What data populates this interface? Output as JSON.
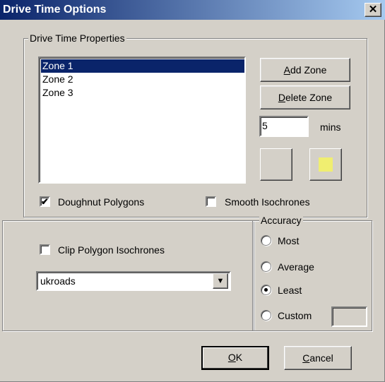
{
  "dialog": {
    "title": "Drive Time Options",
    "close_glyph": "✕"
  },
  "properties": {
    "group_label": "Drive Time Properties",
    "zones": [
      {
        "label": "Zone 1",
        "selected": true
      },
      {
        "label": "Zone 2",
        "selected": false
      },
      {
        "label": "Zone 3",
        "selected": false
      }
    ],
    "add_zone_label": "Add Zone",
    "delete_zone_label": "Delete Zone",
    "minutes_value": "5",
    "minutes_unit": "mins",
    "zone_color": "#f0ee70",
    "doughnut_label": "Doughnut Polygons",
    "doughnut_checked": true,
    "smooth_label": "Smooth Isochrones",
    "smooth_checked": false
  },
  "clip": {
    "label": "Clip Polygon Isochrones",
    "checked": false,
    "layer_value": "ukroads",
    "dropdown_icon": "▼"
  },
  "accuracy": {
    "group_label": "Accuracy",
    "options": [
      {
        "label": "Most",
        "selected": false
      },
      {
        "label": "Average",
        "selected": false
      },
      {
        "label": "Least",
        "selected": true
      },
      {
        "label": "Custom",
        "selected": false
      }
    ],
    "custom_value": ""
  },
  "footer": {
    "ok_label": "OK",
    "cancel_label": "Cancel"
  },
  "icons": {
    "check": "✔"
  }
}
